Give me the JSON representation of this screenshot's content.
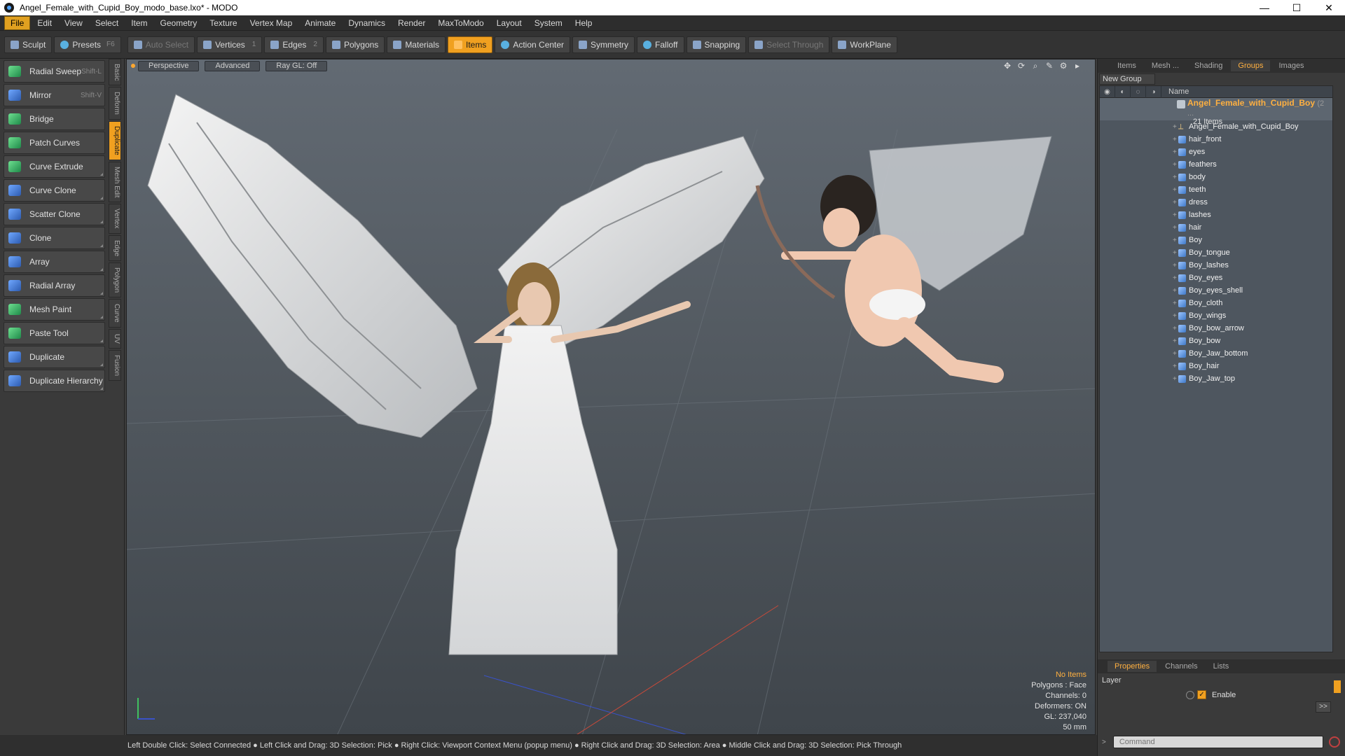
{
  "window": {
    "title": "Angel_Female_with_Cupid_Boy_modo_base.lxo* - MODO",
    "controls": [
      "—",
      "☐",
      "✕"
    ]
  },
  "menu": [
    "File",
    "Edit",
    "View",
    "Select",
    "Item",
    "Geometry",
    "Texture",
    "Vertex Map",
    "Animate",
    "Dynamics",
    "Render",
    "MaxToModo",
    "Layout",
    "System",
    "Help"
  ],
  "toolbar": {
    "sculpt": "Sculpt",
    "presets": "Presets",
    "presets_shortcut": "F6",
    "auto_select": "Auto Select",
    "vertices": "Vertices",
    "vertices_count": "1",
    "edges": "Edges",
    "edges_count": "2",
    "polygons": "Polygons",
    "materials": "Materials",
    "items": "Items",
    "action_center": "Action Center",
    "symmetry": "Symmetry",
    "falloff": "Falloff",
    "snapping": "Snapping",
    "select_through": "Select Through",
    "workplane": "WorkPlane"
  },
  "tools": [
    {
      "label": "Radial Sweep",
      "shortcut": "Shift-L"
    },
    {
      "label": "Mirror",
      "shortcut": "Shift-V"
    },
    {
      "label": "Bridge",
      "shortcut": ""
    },
    {
      "label": "Patch Curves",
      "shortcut": ""
    },
    {
      "label": "Curve Extrude",
      "shortcut": ""
    },
    {
      "label": "Curve Clone",
      "shortcut": ""
    },
    {
      "label": "Scatter Clone",
      "shortcut": ""
    },
    {
      "label": "Clone",
      "shortcut": ""
    },
    {
      "label": "Array",
      "shortcut": ""
    },
    {
      "label": "Radial Array",
      "shortcut": ""
    },
    {
      "label": "Mesh Paint",
      "shortcut": ""
    },
    {
      "label": "Paste Tool",
      "shortcut": ""
    },
    {
      "label": "Duplicate",
      "shortcut": ""
    },
    {
      "label": "Duplicate Hierarchy",
      "shortcut": ""
    }
  ],
  "side_tabs": [
    "Basic",
    "Deform",
    "Duplicate",
    "Mesh Edit",
    "Vertex",
    "Edge",
    "Polygon",
    "Curve",
    "UV",
    "Fusion"
  ],
  "viewport": {
    "perspective": "Perspective",
    "advanced": "Advanced",
    "raygl": "Ray GL: Off",
    "info": {
      "items": "No Items",
      "polygons": "Polygons : Face",
      "channels": "Channels: 0",
      "deformers": "Deformers: ON",
      "gl": "GL: 237,040",
      "focal": "50 mm"
    }
  },
  "status_bar": "Left Double Click: Select Connected ● Left Click and Drag: 3D Selection: Pick ● Right Click: Viewport Context Menu (popup menu) ● Right Click and Drag: 3D Selection: Area ● Middle Click and Drag: 3D Selection: Pick Through",
  "right_panel": {
    "tabs": [
      "Items",
      "Mesh ...",
      "Shading",
      "Groups",
      "Images"
    ],
    "active_tab": "Groups",
    "new_group": "New Group",
    "column_name": "Name",
    "group_name": "Angel_Female_with_Cupid_Boy",
    "group_suffix": "(2 ...",
    "group_count": "21 Items",
    "items": [
      "Angel_Female_with_Cupid_Boy",
      "hair_front",
      "eyes",
      "feathers",
      "body",
      "teeth",
      "dress",
      "lashes",
      "hair",
      "Boy",
      "Boy_tongue",
      "Boy_lashes",
      "Boy_eyes",
      "Boy_eyes_shell",
      "Boy_cloth",
      "Boy_wings",
      "Boy_bow_arrow",
      "Boy_bow",
      "Boy_Jaw_bottom",
      "Boy_hair",
      "Boy_Jaw_top"
    ],
    "props_tabs": [
      "Properties",
      "Channels",
      "Lists"
    ],
    "layer_label": "Layer",
    "enable_label": "Enable",
    "more_label": ">>",
    "command_placeholder": "Command"
  },
  "colors": {
    "accent": "#f0a020",
    "viewport_top": "#626a73",
    "viewport_bottom": "#3f454b"
  }
}
